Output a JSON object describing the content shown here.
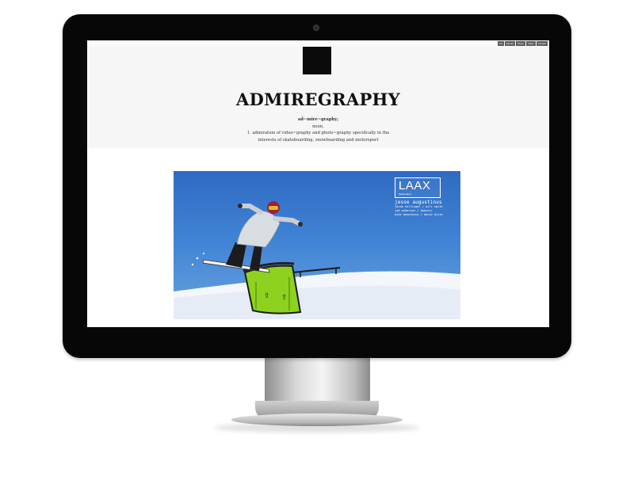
{
  "nav": {
    "items": [
      "Art",
      "Admire",
      "Photo",
      "Video",
      "Contact"
    ]
  },
  "site": {
    "title": "ADMIREGRAPHY",
    "definition": {
      "word": "ad~mire~graphy;",
      "pos": "noun,",
      "line1": "1. admiration of video~graphy and photo~graphy specifically in the",
      "line2": "interests of skateboarding, snowboarding and motorsport"
    }
  },
  "photo": {
    "logo": "LAAX",
    "logo_sub": "Switzerland",
    "rider": "jesse augustinus",
    "credits": [
      "jacob tellinger / will smith",
      "jed anderson / dominic",
      "mike basenesca / david djite"
    ]
  },
  "colors": {
    "bezel": "#070707",
    "header_bg": "#f6f6f6",
    "sky": "#3f82d4",
    "rail_green": "#8ed21f"
  }
}
